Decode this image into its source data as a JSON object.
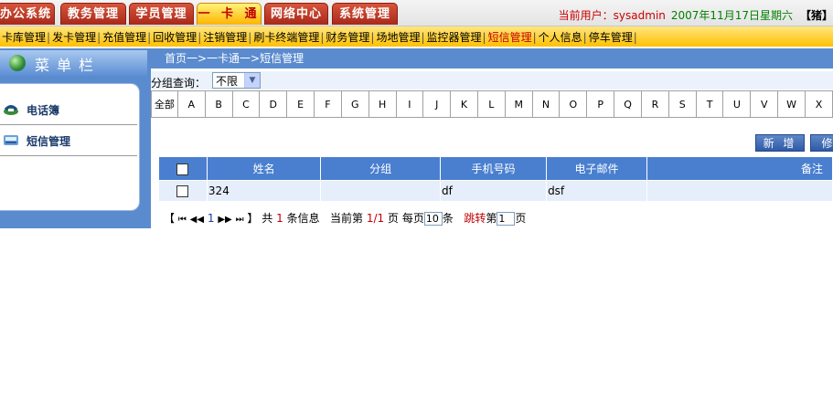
{
  "top_tabs": [
    {
      "label": "办公系统",
      "active": false
    },
    {
      "label": "教务管理",
      "active": false
    },
    {
      "label": "学员管理",
      "active": false
    },
    {
      "label": "一 卡 通",
      "active": true
    },
    {
      "label": "网络中心",
      "active": false
    },
    {
      "label": "系统管理",
      "active": false
    }
  ],
  "user": {
    "label": "当前用户：sysadmin",
    "date": "2007年11月17日星期六",
    "bracket": "【猪】"
  },
  "subnav": [
    "卡库管理",
    "发卡管理",
    "充值管理",
    "回收管理",
    "注销管理",
    "刷卡终端管理",
    "财务管理",
    "场地管理",
    "监控器管理",
    "短信管理",
    "个人信息",
    "停车管理"
  ],
  "subnav_active": "短信管理",
  "sidebar": {
    "title": "菜单栏",
    "items": [
      {
        "label": "电话簿",
        "icon": "phonebook-icon"
      },
      {
        "label": "短信管理",
        "icon": "sms-icon"
      }
    ]
  },
  "breadcrumb": "首页一>一卡通一>短信管理",
  "filter": {
    "label": "分组查询：",
    "selected": "不限"
  },
  "letters": {
    "all": "全部",
    "items": [
      "A",
      "B",
      "C",
      "D",
      "E",
      "F",
      "G",
      "H",
      "I",
      "J",
      "K",
      "L",
      "M",
      "N",
      "O",
      "P",
      "Q",
      "R",
      "S",
      "T",
      "U",
      "V",
      "W",
      "X"
    ]
  },
  "buttons": {
    "add": "新 增",
    "edit": "修"
  },
  "table": {
    "headers": [
      "姓名",
      "分组",
      "手机号码",
      "电子邮件",
      "备注"
    ],
    "rows": [
      {
        "name": "324",
        "group": "",
        "phone": "df",
        "email": "dsf",
        "note": ""
      }
    ]
  },
  "pager": {
    "open": "【",
    "first": "⏮",
    "prev": "◀◀",
    "page_link": "1",
    "next": "▶▶",
    "last": "⏭",
    "close": "】",
    "total_pre": "共",
    "total": "1",
    "total_post": "条信息",
    "current_pre": "当前第",
    "current": "1/1",
    "current_post": "页",
    "per_page_pre": "每页",
    "per_page": "10",
    "per_page_post": "条",
    "jump": "跳转",
    "jump_pre": "第",
    "jump_value": "1",
    "jump_post": "页"
  },
  "colors": {
    "tab_red": "#b8301e",
    "tab_active": "#ffc000",
    "sidebar_blue": "#5b8bcf",
    "header_blue": "#4a7fcf",
    "active_red": "#c00000"
  }
}
